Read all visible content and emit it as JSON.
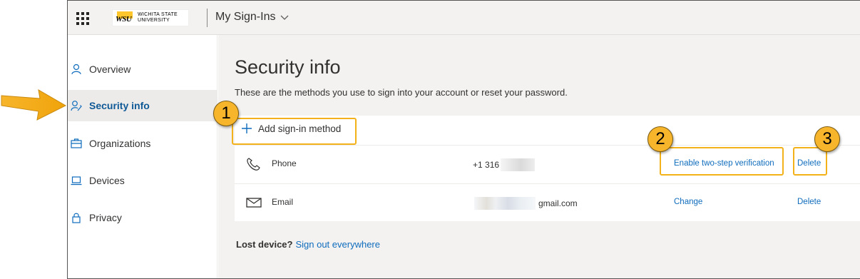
{
  "header": {
    "logo_line1": "WICHITA STATE",
    "logo_line2": "UNIVERSITY",
    "logo_mark": "WSU",
    "app_title": "My Sign-Ins"
  },
  "sidebar": {
    "items": [
      {
        "label": "Overview",
        "icon": "person-icon"
      },
      {
        "label": "Security info",
        "icon": "person-key-icon",
        "active": true
      },
      {
        "label": "Organizations",
        "icon": "briefcase-icon"
      },
      {
        "label": "Devices",
        "icon": "laptop-icon"
      },
      {
        "label": "Privacy",
        "icon": "lock-icon"
      }
    ]
  },
  "main": {
    "title": "Security info",
    "subtitle": "These are the methods you use to sign into your account or reset your password.",
    "add_method_label": "Add sign-in method",
    "methods": [
      {
        "name": "Phone",
        "value": "+1 316",
        "action": "Enable two-step verification",
        "delete": "Delete",
        "icon": "phone-icon"
      },
      {
        "name": "Email",
        "value": "gmail.com",
        "action": "Change",
        "delete": "Delete",
        "icon": "mail-icon"
      }
    ],
    "lost_device_label": "Lost device?",
    "sign_out_label": "Sign out everywhere"
  },
  "callouts": {
    "one": "1",
    "two": "2",
    "three": "3"
  },
  "colors": {
    "accent": "#0f6cbd",
    "highlight": "#f3b11a",
    "badge": "#f7b52c",
    "active_nav_text": "#0f5996"
  }
}
